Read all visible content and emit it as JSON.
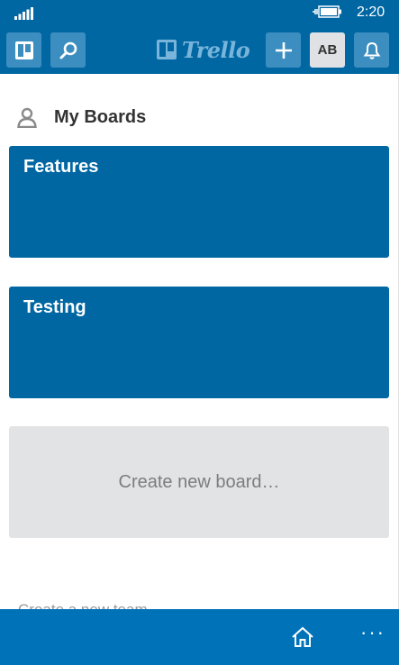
{
  "status_bar": {
    "time": "2:20",
    "signal_icon": "signal-bars-icon",
    "battery_icon": "battery-charging-icon"
  },
  "header": {
    "boards_icon": "boards-icon",
    "search_icon": "search-icon",
    "logo_text": "Trello",
    "add_icon": "plus-icon",
    "avatar_initials": "AB",
    "notifications_icon": "bell-icon"
  },
  "main": {
    "section_title": "My Boards",
    "section_icon": "person-icon",
    "boards": [
      {
        "name": "Features"
      },
      {
        "name": "Testing"
      }
    ],
    "create_board_label": "Create new board…",
    "create_team_label": "Create a new team…"
  },
  "app_bar": {
    "home_icon": "home-icon",
    "more_label": "···"
  },
  "colors": {
    "brand_blue": "#0067a3",
    "board_blue": "#0067a3",
    "app_bar_blue": "#0072b8",
    "button_blue": "#3d8ec0",
    "create_tile_gray": "#e2e3e5"
  }
}
